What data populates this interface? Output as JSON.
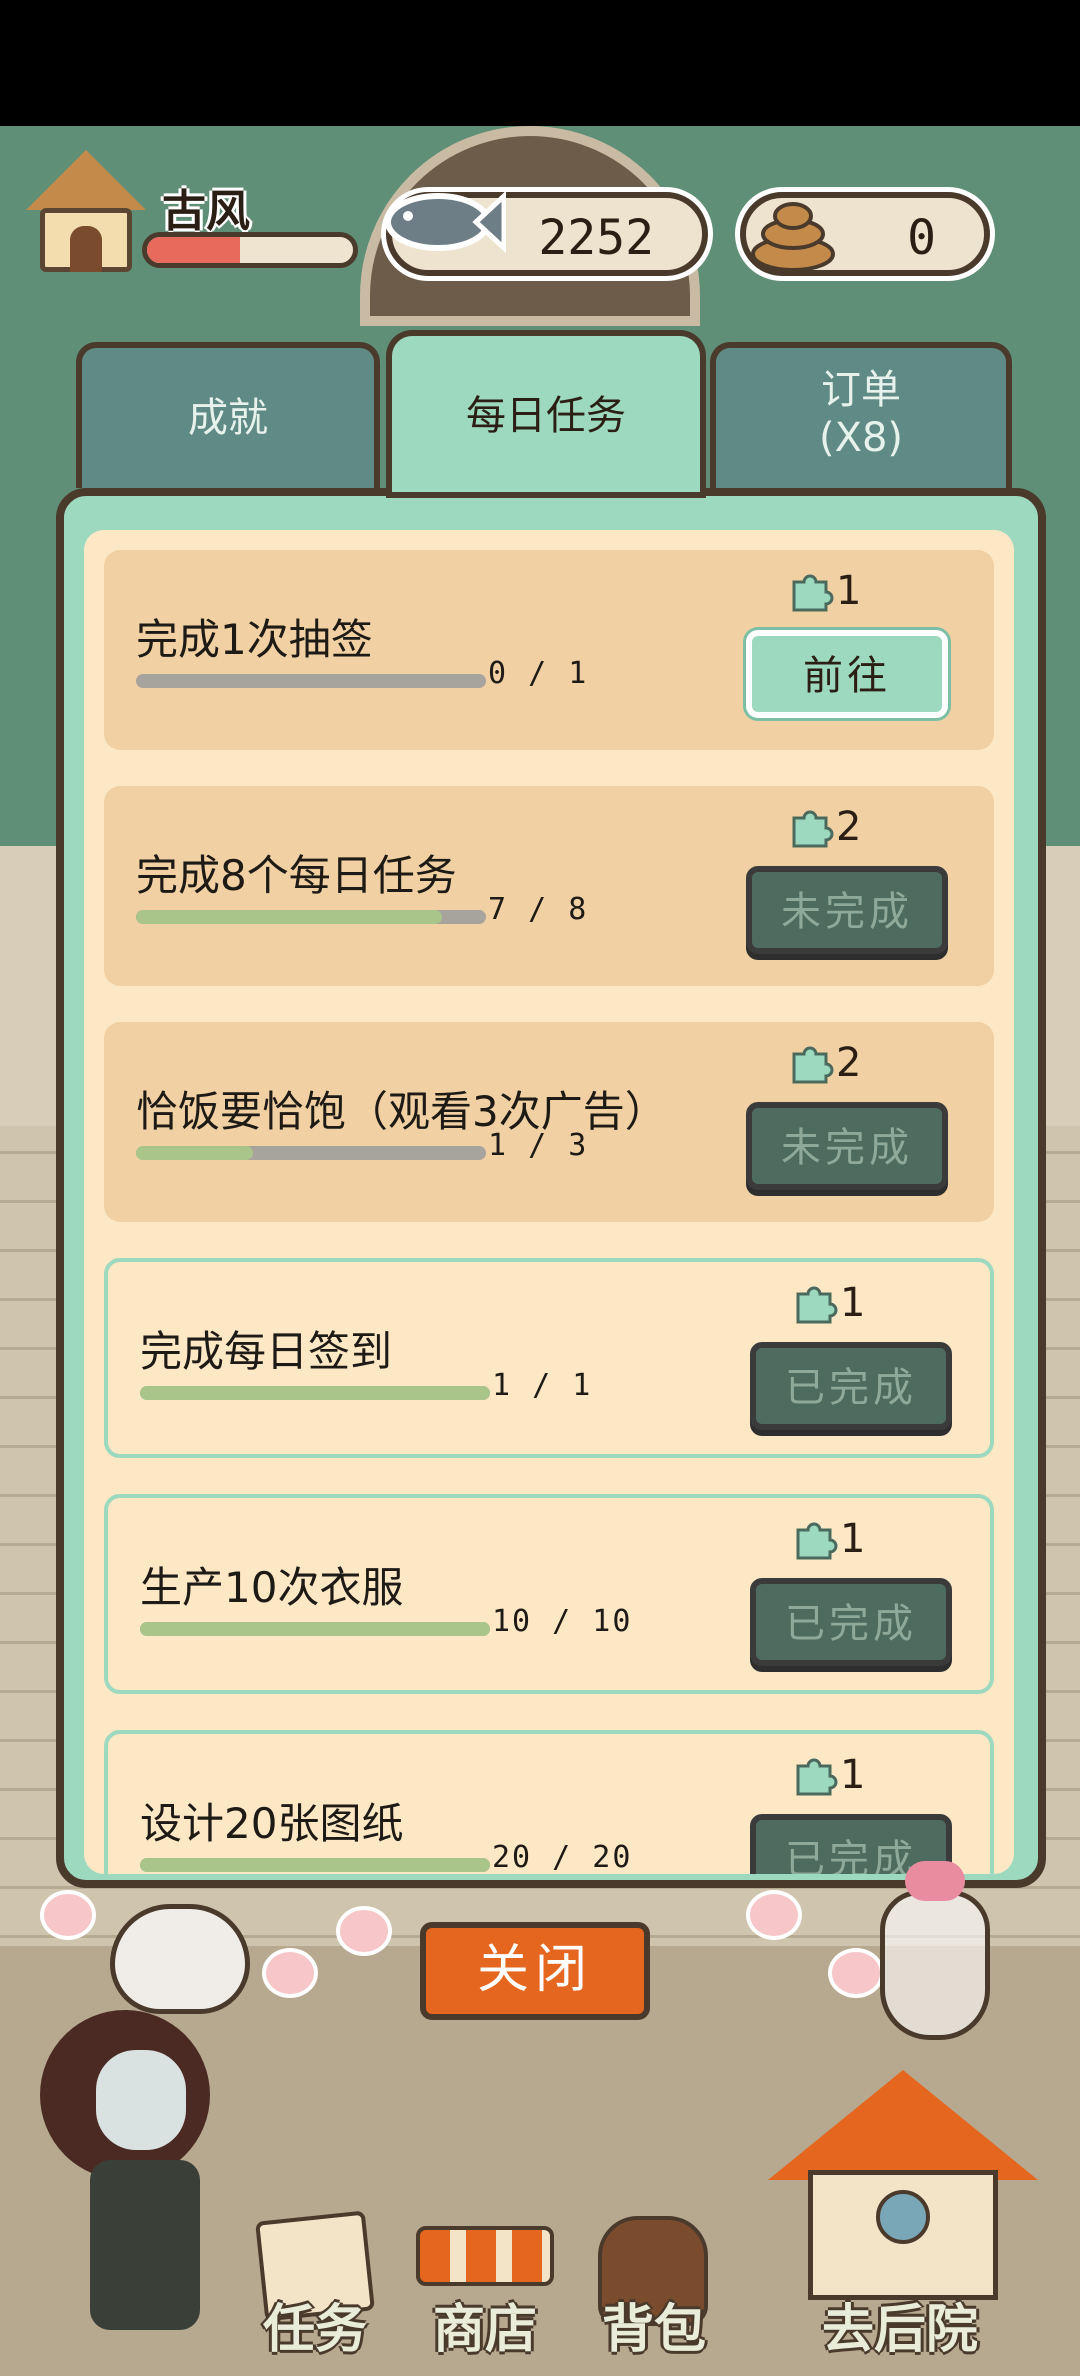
{
  "hud": {
    "player_name": "古风",
    "level_progress": 0.45,
    "fish_count": "2252",
    "poop_count": "0",
    "icons": [
      "house-icon",
      "fish-icon",
      "poop-icon"
    ]
  },
  "tabs": {
    "achievements": "成就",
    "daily": "每日任务",
    "orders_line1": "订单",
    "orders_line2": "(X8)",
    "active": "daily"
  },
  "tasks": [
    {
      "title": "完成1次抽签",
      "progress_text": "0 / 1",
      "current": 0,
      "total": 1,
      "reward": "1",
      "button": "前往",
      "state": "active"
    },
    {
      "title": "完成8个每日任务",
      "progress_text": "7 / 8",
      "current": 7,
      "total": 8,
      "reward": "2",
      "button": "未完成",
      "state": "active"
    },
    {
      "title": "恰饭要恰饱（观看3次广告）",
      "progress_text": "1 / 3",
      "current": 1,
      "total": 3,
      "reward": "2",
      "button": "未完成",
      "state": "active"
    },
    {
      "title": "完成每日签到",
      "progress_text": "1 / 1",
      "current": 1,
      "total": 1,
      "reward": "1",
      "button": "已完成",
      "state": "done"
    },
    {
      "title": "生产10次衣服",
      "progress_text": "10 / 10",
      "current": 10,
      "total": 10,
      "reward": "1",
      "button": "已完成",
      "state": "done"
    },
    {
      "title": "设计20张图纸",
      "progress_text": "20 / 20",
      "current": 20,
      "total": 20,
      "reward": "1",
      "button": "已完成",
      "state": "done"
    }
  ],
  "close_label": "关闭",
  "nav": {
    "task": "任务",
    "shop": "商店",
    "bag": "背包",
    "yard": "去后院"
  },
  "colors": {
    "panel": "#9dd9bf",
    "card_active": "#f1d1a3",
    "card_done": "#fde8c6",
    "progress_fill": "#a9c58a",
    "close_button": "#e5661f"
  }
}
